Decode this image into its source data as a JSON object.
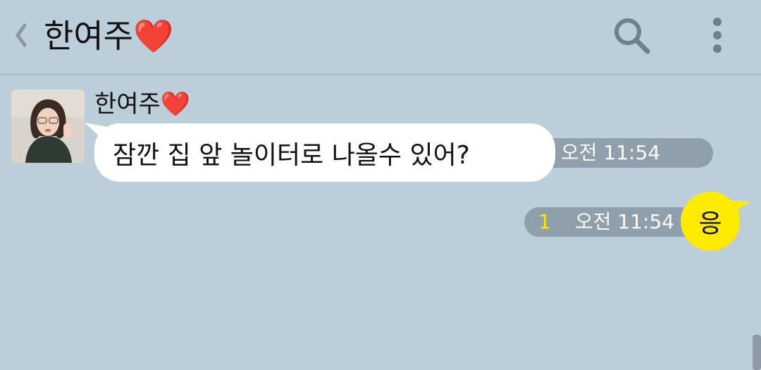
{
  "header": {
    "title": "한여주❤️",
    "back_icon": "chevron-left-icon",
    "search_icon": "search-icon",
    "more_icon": "vertical-dots-icon"
  },
  "messages": [
    {
      "direction": "incoming",
      "sender": "한여주❤️",
      "text": "잠깐 집 앞 놀이터로 나올수 있어?",
      "time": "오전 11:54"
    },
    {
      "direction": "outgoing",
      "text": "응",
      "time": "오전 11:54",
      "unread_count": "1"
    }
  ],
  "colors": {
    "background": "#bdcedb",
    "incoming_bubble": "#ffffff",
    "outgoing_bubble": "#ffeb00",
    "time_pill": "#8f9fac",
    "unread": "#ffe600"
  }
}
